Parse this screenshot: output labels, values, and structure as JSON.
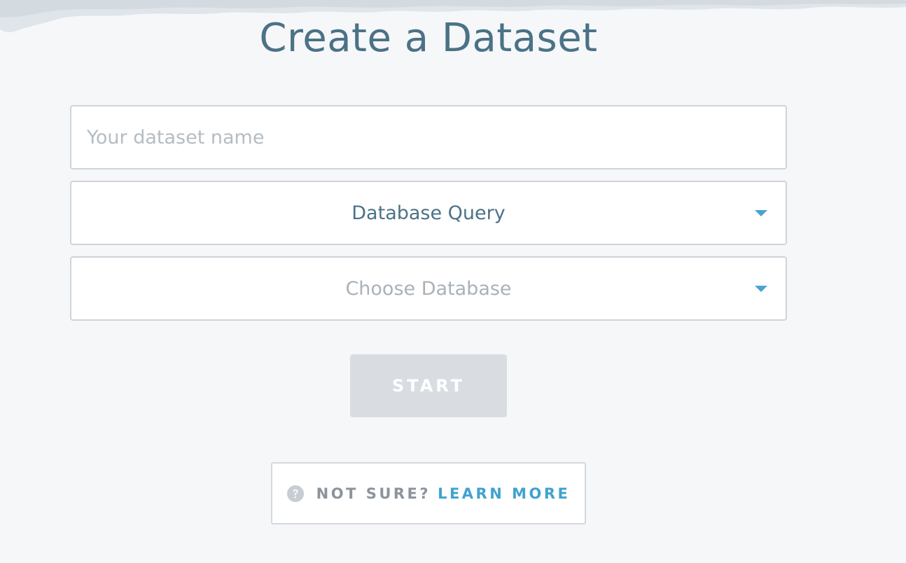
{
  "page": {
    "title": "Create a Dataset"
  },
  "form": {
    "dataset_name": {
      "value": "",
      "placeholder": "Your dataset name"
    },
    "source_type": {
      "selected": "Database Query"
    },
    "database": {
      "placeholder": "Choose Database"
    },
    "start_label": "START"
  },
  "help": {
    "prompt": "NOT SURE?",
    "link_label": "LEARN MORE"
  },
  "icons": {
    "dropdown": "chevron-down-icon",
    "help": "question-circle-icon"
  },
  "colors": {
    "background": "#f6f7f9",
    "title": "#4b7286",
    "accent": "#3fa3cf",
    "button_disabled": "#d9dde2",
    "placeholder": "#b5bcc3"
  }
}
